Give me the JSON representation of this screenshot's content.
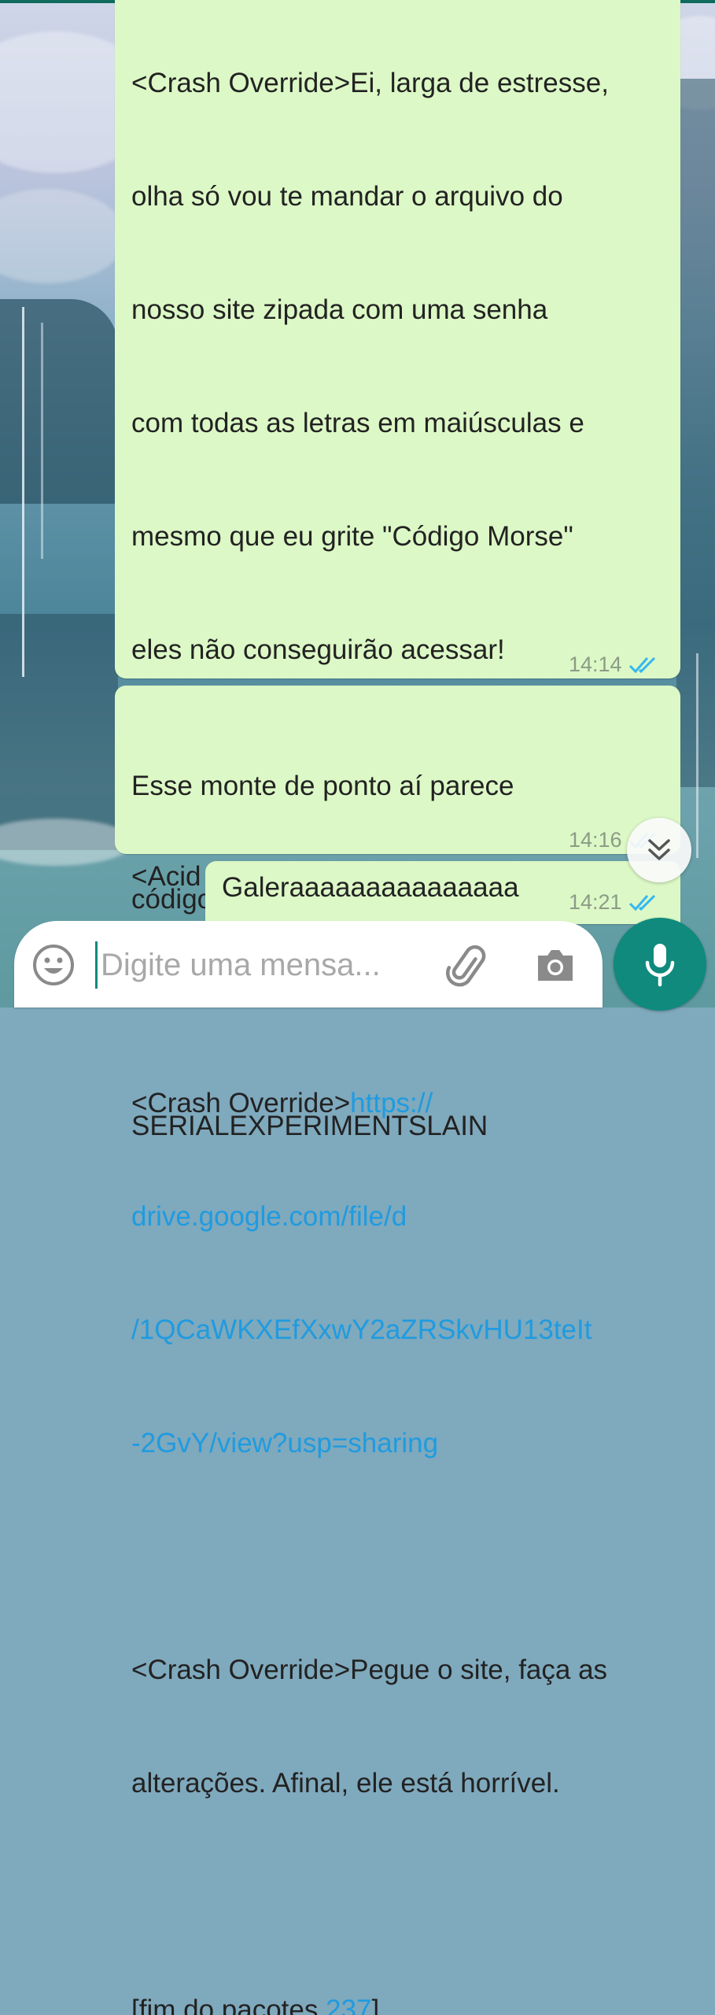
{
  "messages": [
    {
      "lines": [
        "<Crash Override>Ei, larga de estresse,",
        "olha só vou te mandar o arquivo do",
        "nosso site zipada com uma senha",
        "com todas as letras em maiúsculas e",
        "mesmo que eu grite \"Código Morse\"",
        "eles não conseguirão acessar!",
        "",
        "<Acid Burn> Mande o link aí.",
        "",
        "<Crash Override>"
      ],
      "link_lines": [
        "https://",
        "drive.google.com/file/d",
        "/1QCaWKXEfXxwY2aZRSkvHU13teIt",
        "-2GvY/view?usp=sharing"
      ],
      "after_lines": [
        "",
        "<Crash Override>Pegue o site, faça as",
        "alterações. Afinal, ele está horrível.",
        ""
      ],
      "last_prefix": "[fim do pacotes ",
      "last_number": "237",
      "last_suffix": "]",
      "time": "14:14",
      "status": "read"
    },
    {
      "lines": [
        "Esse monte de ponto aí parece",
        "código morse:",
        "",
        "SERIALEXPERIMENTSLAIN"
      ],
      "time": "14:16",
      "status": "read"
    },
    {
      "text": "Galeraaaaaaaaaaaaaaa",
      "time": "14:21",
      "status": "read"
    }
  ],
  "composer": {
    "placeholder": "Digite uma mensa...",
    "emoji_icon": "emoji-icon",
    "attach_icon": "paperclip-icon",
    "camera_icon": "camera-icon",
    "mic_icon": "microphone-icon"
  },
  "scroll_button_icon": "double-chevron-down-icon",
  "colors": {
    "bubble": "#dcf8c6",
    "link": "#1f9be0",
    "accent": "#0f8a7d",
    "read_ticks": "#34b7f1"
  }
}
